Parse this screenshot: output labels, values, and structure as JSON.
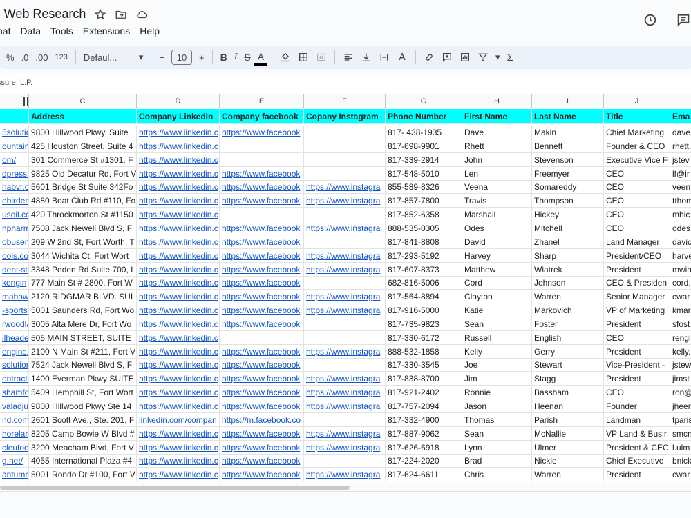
{
  "doc": {
    "title": "| Web Research"
  },
  "menu": [
    "nat",
    "Data",
    "Tools",
    "Extensions",
    "Help"
  ],
  "toolbar": {
    "percent": "%",
    "dec_dec": ".0",
    "dec_inc": ".00",
    "format123": "123",
    "font": "Defaul...",
    "font_size": "10",
    "minus": "−",
    "plus": "+",
    "bold": "B",
    "italic": "I",
    "strike": "S",
    "textcolor": "A",
    "sigma": "Σ"
  },
  "formula_text": "ssure, L.P.",
  "columns": [
    "C",
    "D",
    "E",
    "F",
    "G",
    "H",
    "I",
    "J"
  ],
  "headers": [
    "Address",
    "Company LinkedIn",
    "Company facebook",
    "Copany Instagram",
    "Phone Number",
    "First Name",
    "Last Name",
    "Title",
    "Ema"
  ],
  "rows": [
    [
      "5solutio",
      "9800 Hillwood Pkwy, Suite",
      "https://www.linkedin.c",
      "https://www.facebook",
      "",
      "817- 438-1935",
      "Dave",
      "Makin",
      "Chief Marketing",
      "dave"
    ],
    [
      "ountain",
      "425 Houston Street, Suite 4",
      "https://www.linkedin.c",
      "",
      "",
      "817-698-9901",
      "Rhett",
      "Bennett",
      "Founder & CEO",
      "rhett."
    ],
    [
      "om/",
      "301 Commerce St #1301, F",
      "https://www.linkedin.c",
      "",
      "",
      "817-339-2914",
      "John",
      "Stevenson",
      "Executive Vice F",
      "jstev"
    ],
    [
      "dpress.c",
      "9825 Old Decatur Rd, Fort V",
      "https://www.linkedin.c",
      "https://www.facebook",
      "",
      "817-548-5010",
      "Len",
      "Freemyer",
      "CEO",
      "lf@ir"
    ],
    [
      "habvr.c",
      "5601 Bridge St Suite 342Fo",
      "https://www.linkedin.c",
      "https://www.facebook",
      "https://www.instagra",
      "855-589-8326",
      "Veena",
      "Somareddy",
      "CEO",
      "veen"
    ],
    [
      "ebirden",
      "4880 Boat Club Rd #110, Fo",
      "https://www.linkedin.c",
      "https://www.facebook",
      "https://www.instagra",
      "817-857-7800",
      "Travis",
      "Thompson",
      "CEO",
      "tthom"
    ],
    [
      "usoil.co",
      "420 Throckmorton St #1150",
      "https://www.linkedin.c",
      "",
      "",
      "817-852-6358",
      "Marshall",
      "Hickey",
      "CEO",
      "mhic"
    ],
    [
      "npharm",
      "7508 Jack Newell Blvd S, F",
      "https://www.linkedin.c",
      "https://www.facebook",
      "https://www.instagra",
      "888-535-0305",
      "Odes",
      "Mitchell",
      "CEO",
      "odes"
    ],
    [
      "obusen",
      "209 W 2nd St, Fort Worth, T",
      "https://www.linkedin.c",
      "https://www.facebook",
      "",
      "817-841-8808",
      "David",
      "Zhanel",
      "Land Manager",
      "davic"
    ],
    [
      "ools.co",
      "3044 Wichita Ct, Fort Wort",
      "https://www.linkedin.c",
      "https://www.facebook",
      "https://www.instagra",
      "817-293-5192",
      "Harvey",
      "Sharp",
      "President/CEO",
      "harve"
    ],
    [
      "dent-str",
      "3348 Peden Rd Suite 700, I",
      "https://www.linkedin.c",
      "https://www.facebook",
      "https://www.instagra",
      "817-607-8373",
      "Matthew",
      "Wiatrek",
      "President",
      "mwia"
    ],
    [
      "kengin",
      "777 Main St # 2800, Fort W",
      "https://www.linkedin.c",
      "https://www.facebook",
      "",
      "682-816-5006",
      "Cord",
      "Johnson",
      "CEO & Presiden",
      "cord."
    ],
    [
      "mahawk",
      "2120 RIDGMAR BLVD. SUI",
      "https://www.linkedin.c",
      "https://www.facebook",
      "https://www.instagra",
      "817-564-8894",
      "Clayton",
      "Warren",
      "Senior Manager",
      "cwar"
    ],
    [
      "-sports",
      "5001 Saunders Rd, Fort Wo",
      "https://www.linkedin.c",
      "https://www.facebook",
      "https://www.instagra",
      "817-916-5000",
      "Katie",
      "Markovich",
      "VP of Marketing",
      "kmar"
    ],
    [
      "rwoodla",
      "3005 Alta Mere Dr, Fort Wo",
      "https://www.linkedin.c",
      "https://www.facebook",
      "",
      "817-735-9823",
      "Sean",
      "Foster",
      "President",
      "sfost"
    ],
    [
      "ilheade",
      "505 MAIN STREET, SUITE",
      "https://www.linkedin.c",
      "",
      "",
      "817-330-6172",
      "Russell",
      "English",
      "CEO",
      "rengl"
    ],
    [
      "enginc.",
      "2100 N Main St #211, Fort V",
      "https://www.linkedin.c",
      "https://www.facebook",
      "https://www.instagra",
      "888-532-1858",
      "Kelly",
      "Gerry",
      "President",
      "kelly."
    ],
    [
      "solution",
      "7524 Jack Newell Blvd S, F",
      "https://www.linkedin.c",
      "https://www.facebook",
      "",
      "817-330-3545",
      "Joe",
      "Stewart",
      "Vice-President -",
      "jstew"
    ],
    [
      "ontracto",
      "1400 Everman Pkwy SUITE",
      "https://www.linkedin.c",
      "https://www.facebook",
      "https://www.instagra",
      "817-838-8700",
      "Jim",
      "Stagg",
      "President",
      "jimst"
    ],
    [
      "shamfo",
      "5409 Hemphill St, Fort Wort",
      "https://www.linkedin.c",
      "https://www.facebook",
      "https://www.instagra",
      "817-921-2402",
      "Ronnie",
      "Bassham",
      "CEO",
      "ron@"
    ],
    [
      "valadjus",
      "9800 Hillwood Pkwy Ste 14",
      "https://www.linkedin.c",
      "https://www.facebook",
      "https://www.instagra",
      "817-757-2094",
      "Jason",
      "Heenan",
      "Founder",
      "jheen"
    ],
    [
      "nd.com",
      "2601 Scott Ave., Ste. 201, F",
      "linkedin.com/compan",
      "https://m.facebook.co",
      "",
      "817-332-4900",
      "Thomas",
      "Parish",
      "Landman",
      "tparis"
    ],
    [
      "horelar",
      "8205 Camp Bowie W Blvd #",
      "https://www.linkedin.c",
      "https://www.facebook",
      "https://www.instagra",
      "817-887-9062",
      "Sean",
      "McNallie",
      "VP Land & Busir",
      "smcn"
    ],
    [
      "cleufoo",
      "3200 Meacham Blvd, Fort V",
      "https://www.linkedin.c",
      "https://www.facebook",
      "https://www.instagra",
      "817-626-6918",
      "Lynn",
      "Ulmer",
      "President & CEC",
      "l.ulm"
    ],
    [
      "g.net/",
      "4055 International Plaza #4",
      "https://www.linkedin.c",
      "https://www.facebook",
      "",
      "817-224-2020",
      "Brad",
      "Nickle",
      "Chief Executive",
      "bnick"
    ],
    [
      "antumr",
      "5001 Rondo Dr #100, Fort V",
      "https://www.linkedin.c",
      "https://www.facebook",
      "https://www.instagra",
      "817-624-6611",
      "Chris",
      "Warren",
      "President",
      "cwar"
    ]
  ]
}
